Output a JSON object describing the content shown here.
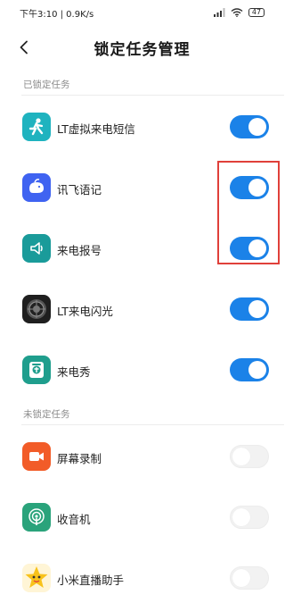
{
  "status_bar": {
    "time_speed": "下午3:10 | 0.9K/s",
    "battery": "47"
  },
  "header": {
    "title": "锁定任务管理"
  },
  "sections": {
    "locked_label": "已锁定任务",
    "unlocked_label": "未锁定任务"
  },
  "locked_apps": [
    {
      "name": "LT虚拟来电短信",
      "icon": "running-person-icon",
      "enabled": true
    },
    {
      "name": "讯飞语记",
      "icon": "whale-icon",
      "enabled": true
    },
    {
      "name": "来电报号",
      "icon": "speaker-icon",
      "enabled": true
    },
    {
      "name": "LT来电闪光",
      "icon": "lens-icon",
      "enabled": true
    },
    {
      "name": "来电秀",
      "icon": "phone-show-icon",
      "enabled": true
    }
  ],
  "unlocked_apps": [
    {
      "name": "屏幕录制",
      "icon": "video-camera-icon",
      "enabled": false
    },
    {
      "name": "收音机",
      "icon": "radio-icon",
      "enabled": false
    },
    {
      "name": "小米直播助手",
      "icon": "star-mascot-icon",
      "enabled": false
    }
  ],
  "colors": {
    "toggle_on": "#1b82e8",
    "toggle_off": "#f2f2f2",
    "highlight": "#e0403a"
  }
}
